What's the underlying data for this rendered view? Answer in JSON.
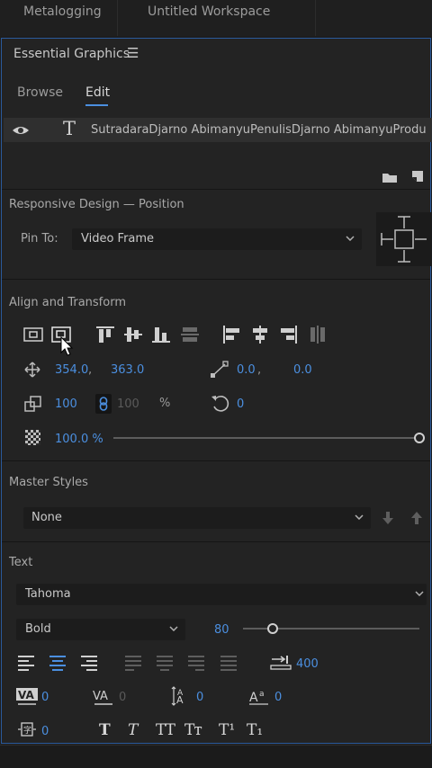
{
  "workspaces": [
    "Metalogging",
    "Untitled Workspace"
  ],
  "panel": {
    "title": "Essential Graphics",
    "tabs": [
      "Browse",
      "Edit"
    ],
    "active_tab": "Edit",
    "layer_name": "SutradaraDjarno AbimanyuPenulisDjarno AbimanyuProdu..."
  },
  "responsive": {
    "heading": "Responsive Design — Position",
    "pin_label": "Pin To:",
    "pin_value": "Video Frame"
  },
  "align": {
    "heading": "Align and Transform",
    "pos_x": "354.0",
    "pos_sep": ",",
    "pos_y": "363.0",
    "anchor_x": "0.0",
    "anchor_sep": ",",
    "anchor_y": "0.0",
    "scale": "100",
    "scale_h": "100",
    "scale_unit": "%",
    "rotation": "0",
    "opacity": "100.0 %",
    "opacity_level": 1.0
  },
  "master": {
    "heading": "Master Styles",
    "value": "None"
  },
  "text": {
    "heading": "Text",
    "font": "Tahoma",
    "style": "Bold",
    "size": "80",
    "size_level": 0.17,
    "tab_width": "400",
    "kerning": "0",
    "tracking": "0",
    "leading": "0",
    "baseline": "0",
    "tsume": "0",
    "style_buttons": [
      "T",
      "T",
      "TT",
      "Tт",
      "T¹",
      "T₁"
    ]
  }
}
